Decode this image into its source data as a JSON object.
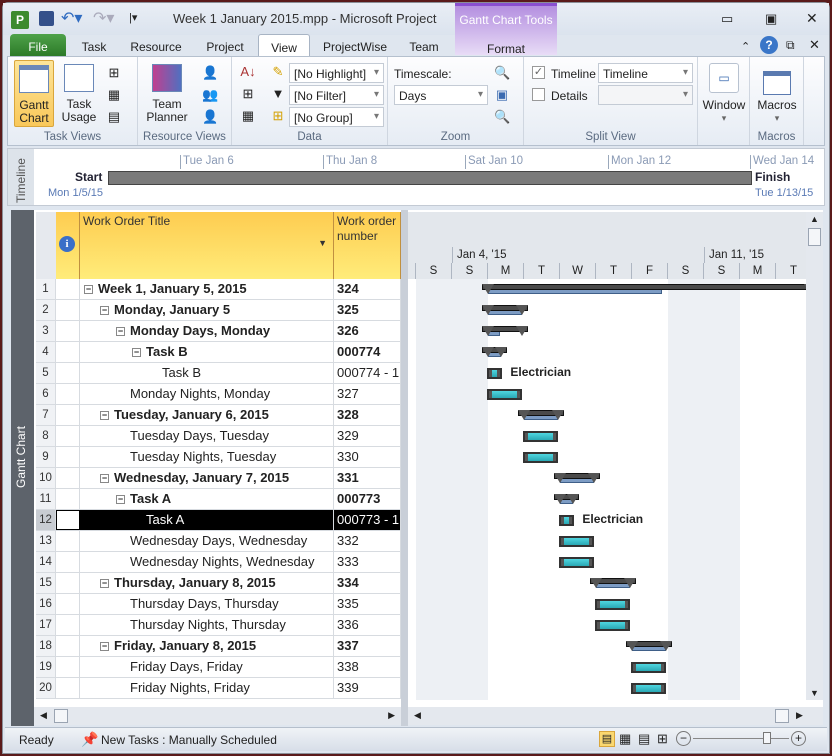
{
  "window": {
    "title": "Week 1 January 2015.mpp  -  Microsoft Project",
    "context_tab_group": "Gantt Chart Tools",
    "context_tab": "Format"
  },
  "tabs": [
    {
      "label": "File"
    },
    {
      "label": "Task"
    },
    {
      "label": "Resource"
    },
    {
      "label": "Project"
    },
    {
      "label": "View"
    },
    {
      "label": "ProjectWise"
    },
    {
      "label": "Team"
    }
  ],
  "ribbon": {
    "task_views": {
      "label": "Task Views",
      "gantt": "Gantt",
      "gantt2": "Chart",
      "usage": "Task",
      "usage2": "Usage"
    },
    "resource_views": {
      "label": "Resource Views",
      "team": "Team",
      "team2": "Planner"
    },
    "data": {
      "label": "Data",
      "highlight": "[No Highlight]",
      "filter": "[No Filter]",
      "group": "[No Group]"
    },
    "zoom": {
      "label": "Zoom",
      "timescale_label": "Timescale:",
      "timescale": "Days"
    },
    "split_view": {
      "label": "Split View",
      "timeline_label": "Timeline",
      "timeline_checked": true,
      "timeline_value": "Timeline",
      "details_label": "Details",
      "details_checked": false
    },
    "window": {
      "label": "Window"
    },
    "macros": {
      "label": "Macros",
      "group": "Macros"
    }
  },
  "timeline": {
    "side": "Timeline",
    "start": "Start",
    "finish": "Finish",
    "start_date": "Mon 1/5/15",
    "finish_date": "Tue 1/13/15",
    "ticks": [
      "Tue Jan 6",
      "Thu Jan 8",
      "Sat Jan 10",
      "Mon Jan 12",
      "Wed Jan 14"
    ]
  },
  "view_label": "Gantt Chart",
  "table": {
    "columns": [
      "Work Order Title",
      "Work order number"
    ],
    "rows": [
      {
        "id": "1",
        "title": "Week 1, January 5, 2015",
        "num": "324",
        "level": 0,
        "summary": true,
        "bar": {
          "type": "summary",
          "start": 1.83,
          "end": 11.1,
          "progress": 0.54
        }
      },
      {
        "id": "2",
        "title": "Monday, January 5",
        "num": "325",
        "level": 1,
        "summary": true,
        "bar": {
          "type": "summary",
          "start": 1.83,
          "end": 3.1,
          "progress": 1
        }
      },
      {
        "id": "3",
        "title": "Monday Days, Monday",
        "num": "326",
        "level": 2,
        "summary": true,
        "bar": {
          "type": "summary",
          "start": 1.83,
          "end": 3.1,
          "progress": 0.35
        }
      },
      {
        "id": "4",
        "title": "Task B",
        "num": "000774",
        "level": 3,
        "summary": true,
        "bar": {
          "type": "summary",
          "start": 1.83,
          "end": 2.53,
          "progress": 1
        }
      },
      {
        "id": "5",
        "title": "Task B",
        "num": "000774 - 1",
        "level": 4,
        "summary": false,
        "bar": {
          "type": "task",
          "start": 1.97,
          "end": 2.4,
          "label": "Electrician"
        }
      },
      {
        "id": "6",
        "title": "Monday Nights, Monday",
        "num": "327",
        "level": 2,
        "summary": false,
        "bar": {
          "type": "task",
          "start": 1.97,
          "end": 2.95
        }
      },
      {
        "id": "7",
        "title": "Tuesday, January 6, 2015",
        "num": "328",
        "level": 1,
        "summary": true,
        "bar": {
          "type": "summary",
          "start": 2.83,
          "end": 4.1,
          "progress": 1
        }
      },
      {
        "id": "8",
        "title": "Tuesday Days, Tuesday",
        "num": "329",
        "level": 2,
        "summary": false,
        "bar": {
          "type": "task",
          "start": 2.97,
          "end": 3.95
        }
      },
      {
        "id": "9",
        "title": "Tuesday Nights, Tuesday",
        "num": "330",
        "level": 2,
        "summary": false,
        "bar": {
          "type": "task",
          "start": 2.97,
          "end": 3.95
        }
      },
      {
        "id": "10",
        "title": "Wednesday, January 7, 2015",
        "num": "331",
        "level": 1,
        "summary": true,
        "bar": {
          "type": "summary",
          "start": 3.83,
          "end": 5.1,
          "progress": 1
        }
      },
      {
        "id": "11",
        "title": "Task A",
        "num": "000773",
        "level": 2,
        "summary": true,
        "bar": {
          "type": "summary",
          "start": 3.83,
          "end": 4.53,
          "progress": 1
        }
      },
      {
        "id": "12",
        "title": "Task A",
        "num": "000773 - 1",
        "level": 3,
        "summary": false,
        "selected": true,
        "bar": {
          "type": "task",
          "start": 3.97,
          "end": 4.4,
          "label": "Electrician"
        }
      },
      {
        "id": "13",
        "title": "Wednesday Days, Wednesday",
        "num": "332",
        "level": 2,
        "summary": false,
        "bar": {
          "type": "task",
          "start": 3.97,
          "end": 4.95
        }
      },
      {
        "id": "14",
        "title": "Wednesday Nights, Wednesday",
        "num": "333",
        "level": 2,
        "summary": false,
        "bar": {
          "type": "task",
          "start": 3.97,
          "end": 4.95
        }
      },
      {
        "id": "15",
        "title": "Thursday, January 8, 2015",
        "num": "334",
        "level": 1,
        "summary": true,
        "bar": {
          "type": "summary",
          "start": 4.83,
          "end": 6.1,
          "progress": 1
        }
      },
      {
        "id": "16",
        "title": "Thursday Days, Thursday",
        "num": "335",
        "level": 2,
        "summary": false,
        "bar": {
          "type": "task",
          "start": 4.97,
          "end": 5.95
        }
      },
      {
        "id": "17",
        "title": "Thursday Nights, Thursday",
        "num": "336",
        "level": 2,
        "summary": false,
        "bar": {
          "type": "task",
          "start": 4.97,
          "end": 5.95
        }
      },
      {
        "id": "18",
        "title": "Friday, January 8, 2015",
        "num": "337",
        "level": 1,
        "summary": true,
        "bar": {
          "type": "summary",
          "start": 5.83,
          "end": 7.1,
          "progress": 1
        }
      },
      {
        "id": "19",
        "title": "Friday Days, Friday",
        "num": "338",
        "level": 2,
        "summary": false,
        "bar": {
          "type": "task",
          "start": 5.97,
          "end": 6.95
        }
      },
      {
        "id": "20",
        "title": "Friday Nights, Friday",
        "num": "339",
        "level": 2,
        "summary": false,
        "bar": {
          "type": "task",
          "start": 5.97,
          "end": 6.95
        }
      }
    ]
  },
  "gantt": {
    "weeks": [
      "Jan 4, '15",
      "Jan 11, '15"
    ],
    "days": [
      "S",
      "S",
      "M",
      "T",
      "W",
      "T",
      "F",
      "S",
      "S",
      "M",
      "T"
    ],
    "nonworking": [
      0,
      1,
      7,
      8
    ]
  },
  "status": {
    "ready": "Ready",
    "new_tasks": "New Tasks : Manually Scheduled"
  },
  "colors": {
    "summary": "#4a4a4a",
    "progress": "#7d9cc4",
    "task": "#4fd6e0",
    "selected": "#000000"
  }
}
